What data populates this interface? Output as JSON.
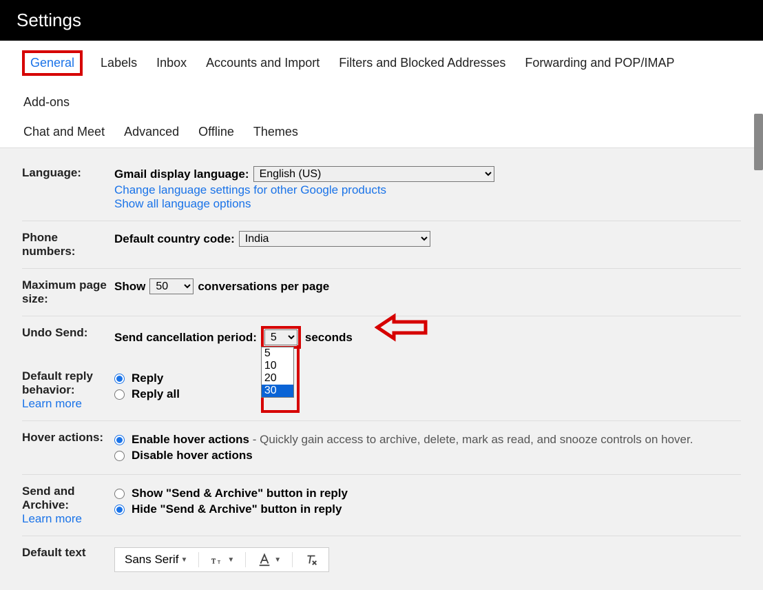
{
  "header": {
    "title": "Settings"
  },
  "tabs": {
    "row1": [
      "General",
      "Labels",
      "Inbox",
      "Accounts and Import",
      "Filters and Blocked Addresses",
      "Forwarding and POP/IMAP",
      "Add-ons"
    ],
    "row2": [
      "Chat and Meet",
      "Advanced",
      "Offline",
      "Themes"
    ],
    "active": "General"
  },
  "language": {
    "label": "Language:",
    "display_label": "Gmail display language:",
    "display_value": "English (US)",
    "change_link": "Change language settings for other Google products",
    "show_all_link": "Show all language options"
  },
  "phone": {
    "label": "Phone numbers:",
    "default_label": "Default country code:",
    "default_value": "India"
  },
  "pagesize": {
    "label": "Maximum page size:",
    "show": "Show",
    "value": "50",
    "per_page": "conversations per page"
  },
  "undo": {
    "label": "Undo Send:",
    "period_label": "Send cancellation period:",
    "value": "5",
    "options": [
      "5",
      "10",
      "20",
      "30"
    ],
    "seconds": "seconds"
  },
  "reply": {
    "label": "Default reply behavior:",
    "learn": "Learn more",
    "opt1": "Reply",
    "opt2": "Reply all",
    "selected": "Reply"
  },
  "hover": {
    "label": "Hover actions:",
    "opt1": "Enable hover actions",
    "opt1_desc": " - Quickly gain access to archive, delete, mark as read, and snooze controls on hover.",
    "opt2": "Disable hover actions",
    "selected": "Enable hover actions"
  },
  "sendarchive": {
    "label": "Send and Archive:",
    "learn": "Learn more",
    "opt1": "Show \"Send & Archive\" button in reply",
    "opt2": "Hide \"Send & Archive\" button in reply",
    "selected": "Hide \"Send & Archive\" button in reply"
  },
  "textstyle": {
    "label": "Default text",
    "font": "Sans Serif"
  }
}
